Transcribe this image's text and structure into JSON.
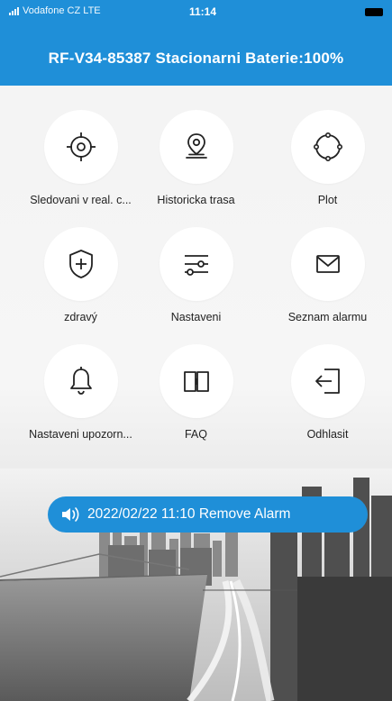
{
  "status": {
    "carrier": "Vodafone CZ  LTE",
    "time": "11:14"
  },
  "header": {
    "title": "RF-V34-85387 Stacionarni Baterie:100%"
  },
  "menu": [
    {
      "label": "Sledovani v real. c...",
      "icon": "crosshair-icon"
    },
    {
      "label": "Historicka trasa",
      "icon": "map-pin-icon"
    },
    {
      "label": "Plot",
      "icon": "geofence-circle-icon"
    },
    {
      "label": "zdravý",
      "icon": "shield-plus-icon"
    },
    {
      "label": "Nastaveni",
      "icon": "sliders-icon"
    },
    {
      "label": "Seznam alarmu",
      "icon": "envelope-icon"
    },
    {
      "label": "Nastaveni upozorn...",
      "icon": "bell-icon"
    },
    {
      "label": "FAQ",
      "icon": "book-icon"
    },
    {
      "label": "Odhlasit",
      "icon": "logout-icon"
    }
  ],
  "alarm": {
    "text": "2022/02/22 11:10 Remove Alarm",
    "icon": "speaker-icon"
  },
  "colors": {
    "accent": "#1f8fd8",
    "background": "#f4f4f4"
  }
}
